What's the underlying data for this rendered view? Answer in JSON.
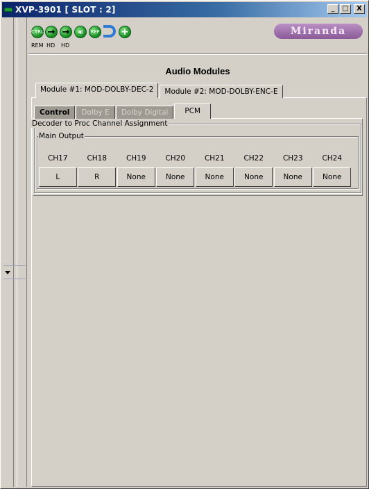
{
  "window": {
    "title": "XVP-3901 [ SLOT : 2]",
    "minimize": "_",
    "maximize": "□",
    "close": "X"
  },
  "toolbar": {
    "icons": [
      {
        "name": "ctrl-icon",
        "text": "CTRL",
        "label": "REM"
      },
      {
        "name": "hd-arrow-icon",
        "text": "→",
        "label": "HD"
      },
      {
        "name": "hd-arrow-icon-2",
        "text": "→",
        "label": "HD"
      },
      {
        "name": "audio-icon",
        "text": "◀)",
        "label": ""
      },
      {
        "name": "ref-icon",
        "text": "REF",
        "label": ""
      },
      {
        "name": "uturn-icon",
        "text": "",
        "label": ""
      },
      {
        "name": "plus-icon",
        "text": "+",
        "label": ""
      }
    ],
    "logo": "Miranda"
  },
  "panel": {
    "title": "Audio Modules"
  },
  "module_tabs": [
    {
      "label": "Module #1: MOD-DOLBY-DEC-2",
      "active": true
    },
    {
      "label": "Module #2: MOD-DOLBY-ENC-E",
      "active": false
    }
  ],
  "sub_tabs": [
    {
      "label": "Control",
      "state": "enabled"
    },
    {
      "label": "Dolby E",
      "state": "disabled"
    },
    {
      "label": "Dolby Digital",
      "state": "disabled"
    },
    {
      "label": "PCM",
      "state": "active"
    }
  ],
  "pcm": {
    "group_title": "Decoder to Proc Channel Assignment",
    "sub_group_title": "Main Output",
    "channels": [
      {
        "name": "CH17",
        "value": "L"
      },
      {
        "name": "CH18",
        "value": "R"
      },
      {
        "name": "CH19",
        "value": "None"
      },
      {
        "name": "CH20",
        "value": "None"
      },
      {
        "name": "CH21",
        "value": "None"
      },
      {
        "name": "CH22",
        "value": "None"
      },
      {
        "name": "CH23",
        "value": "None"
      },
      {
        "name": "CH24",
        "value": "None"
      }
    ]
  },
  "colors": {
    "titlebar": "#0a246a",
    "face": "#d4d0c8",
    "logo": "#8a5a98",
    "status_green": "#14881e"
  }
}
